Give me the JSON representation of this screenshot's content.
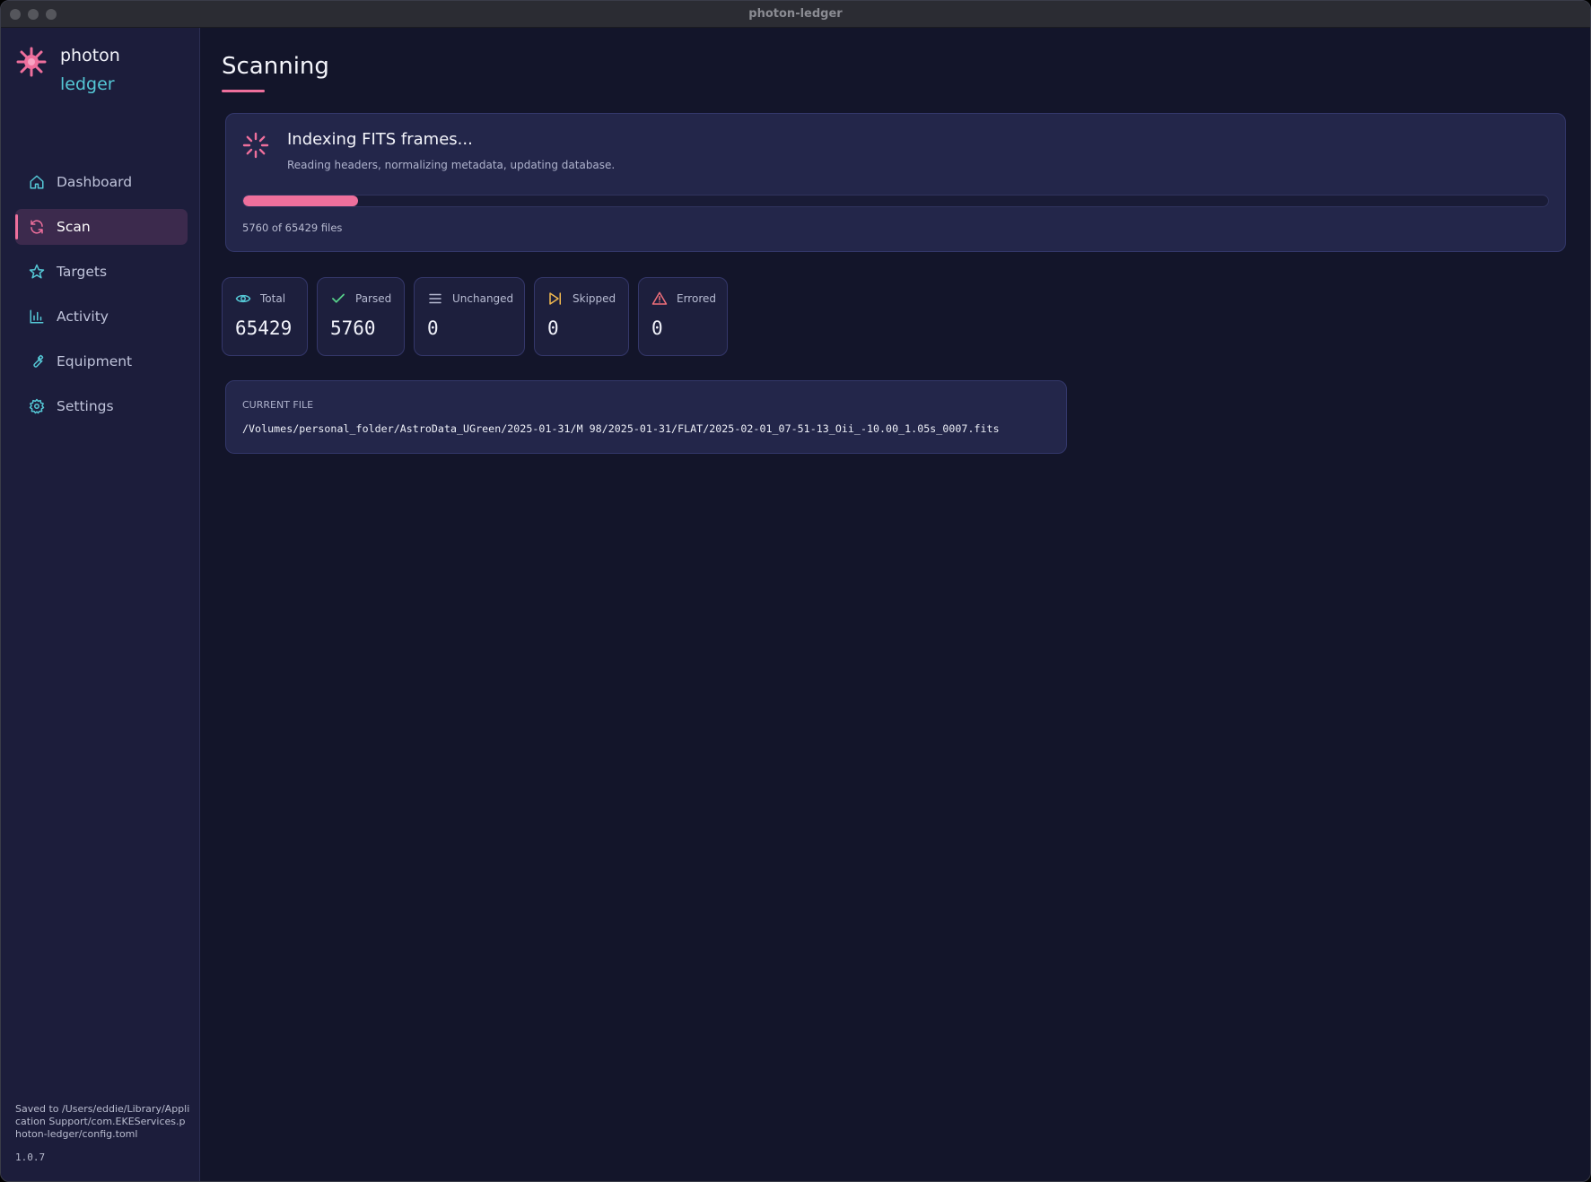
{
  "window": {
    "title": "photon-ledger"
  },
  "brand": {
    "line1": "photon",
    "line2": "ledger"
  },
  "sidebar": {
    "items": [
      {
        "label": "Dashboard",
        "icon": "home-icon",
        "active": false
      },
      {
        "label": "Scan",
        "icon": "refresh-icon",
        "active": true
      },
      {
        "label": "Targets",
        "icon": "star-icon",
        "active": false
      },
      {
        "label": "Activity",
        "icon": "bar-chart-icon",
        "active": false
      },
      {
        "label": "Equipment",
        "icon": "wrench-icon",
        "active": false
      },
      {
        "label": "Settings",
        "icon": "gear-icon",
        "active": false
      }
    ],
    "footer": {
      "saved_to": "Saved to /Users/eddie/Library/Application Support/com.EKEServices.photon-ledger/config.toml",
      "version": "1.0.7"
    }
  },
  "page": {
    "title": "Scanning"
  },
  "progress": {
    "title": "Indexing FITS frames...",
    "subtitle": "Reading headers, normalizing metadata, updating database.",
    "count_text": "5760 of 65429 files",
    "done": 5760,
    "total": 65429
  },
  "stats": [
    {
      "label": "Total",
      "value": "65429",
      "icon": "eye-icon",
      "color": "#55c8d6"
    },
    {
      "label": "Parsed",
      "value": "5760",
      "icon": "check-icon",
      "color": "#57d08a"
    },
    {
      "label": "Unchanged",
      "value": "0",
      "icon": "lines-icon",
      "color": "#b8bcd3"
    },
    {
      "label": "Skipped",
      "value": "0",
      "icon": "skip-icon",
      "color": "#f2b94f"
    },
    {
      "label": "Errored",
      "value": "0",
      "icon": "warning-icon",
      "color": "#ee6f7a"
    }
  ],
  "current_file": {
    "label": "CURRENT FILE",
    "path": "/Volumes/personal_folder/AstroData_UGreen/2025-01-31/M 98/2025-01-31/FLAT/2025-02-01_07-51-13_Oii_-10.00_1.05s_0007.fits"
  },
  "colors": {
    "accent": "#ee6f9c",
    "teal": "#55c8d6",
    "bg": "#13152a",
    "sidebar": "#1c1d3b"
  }
}
